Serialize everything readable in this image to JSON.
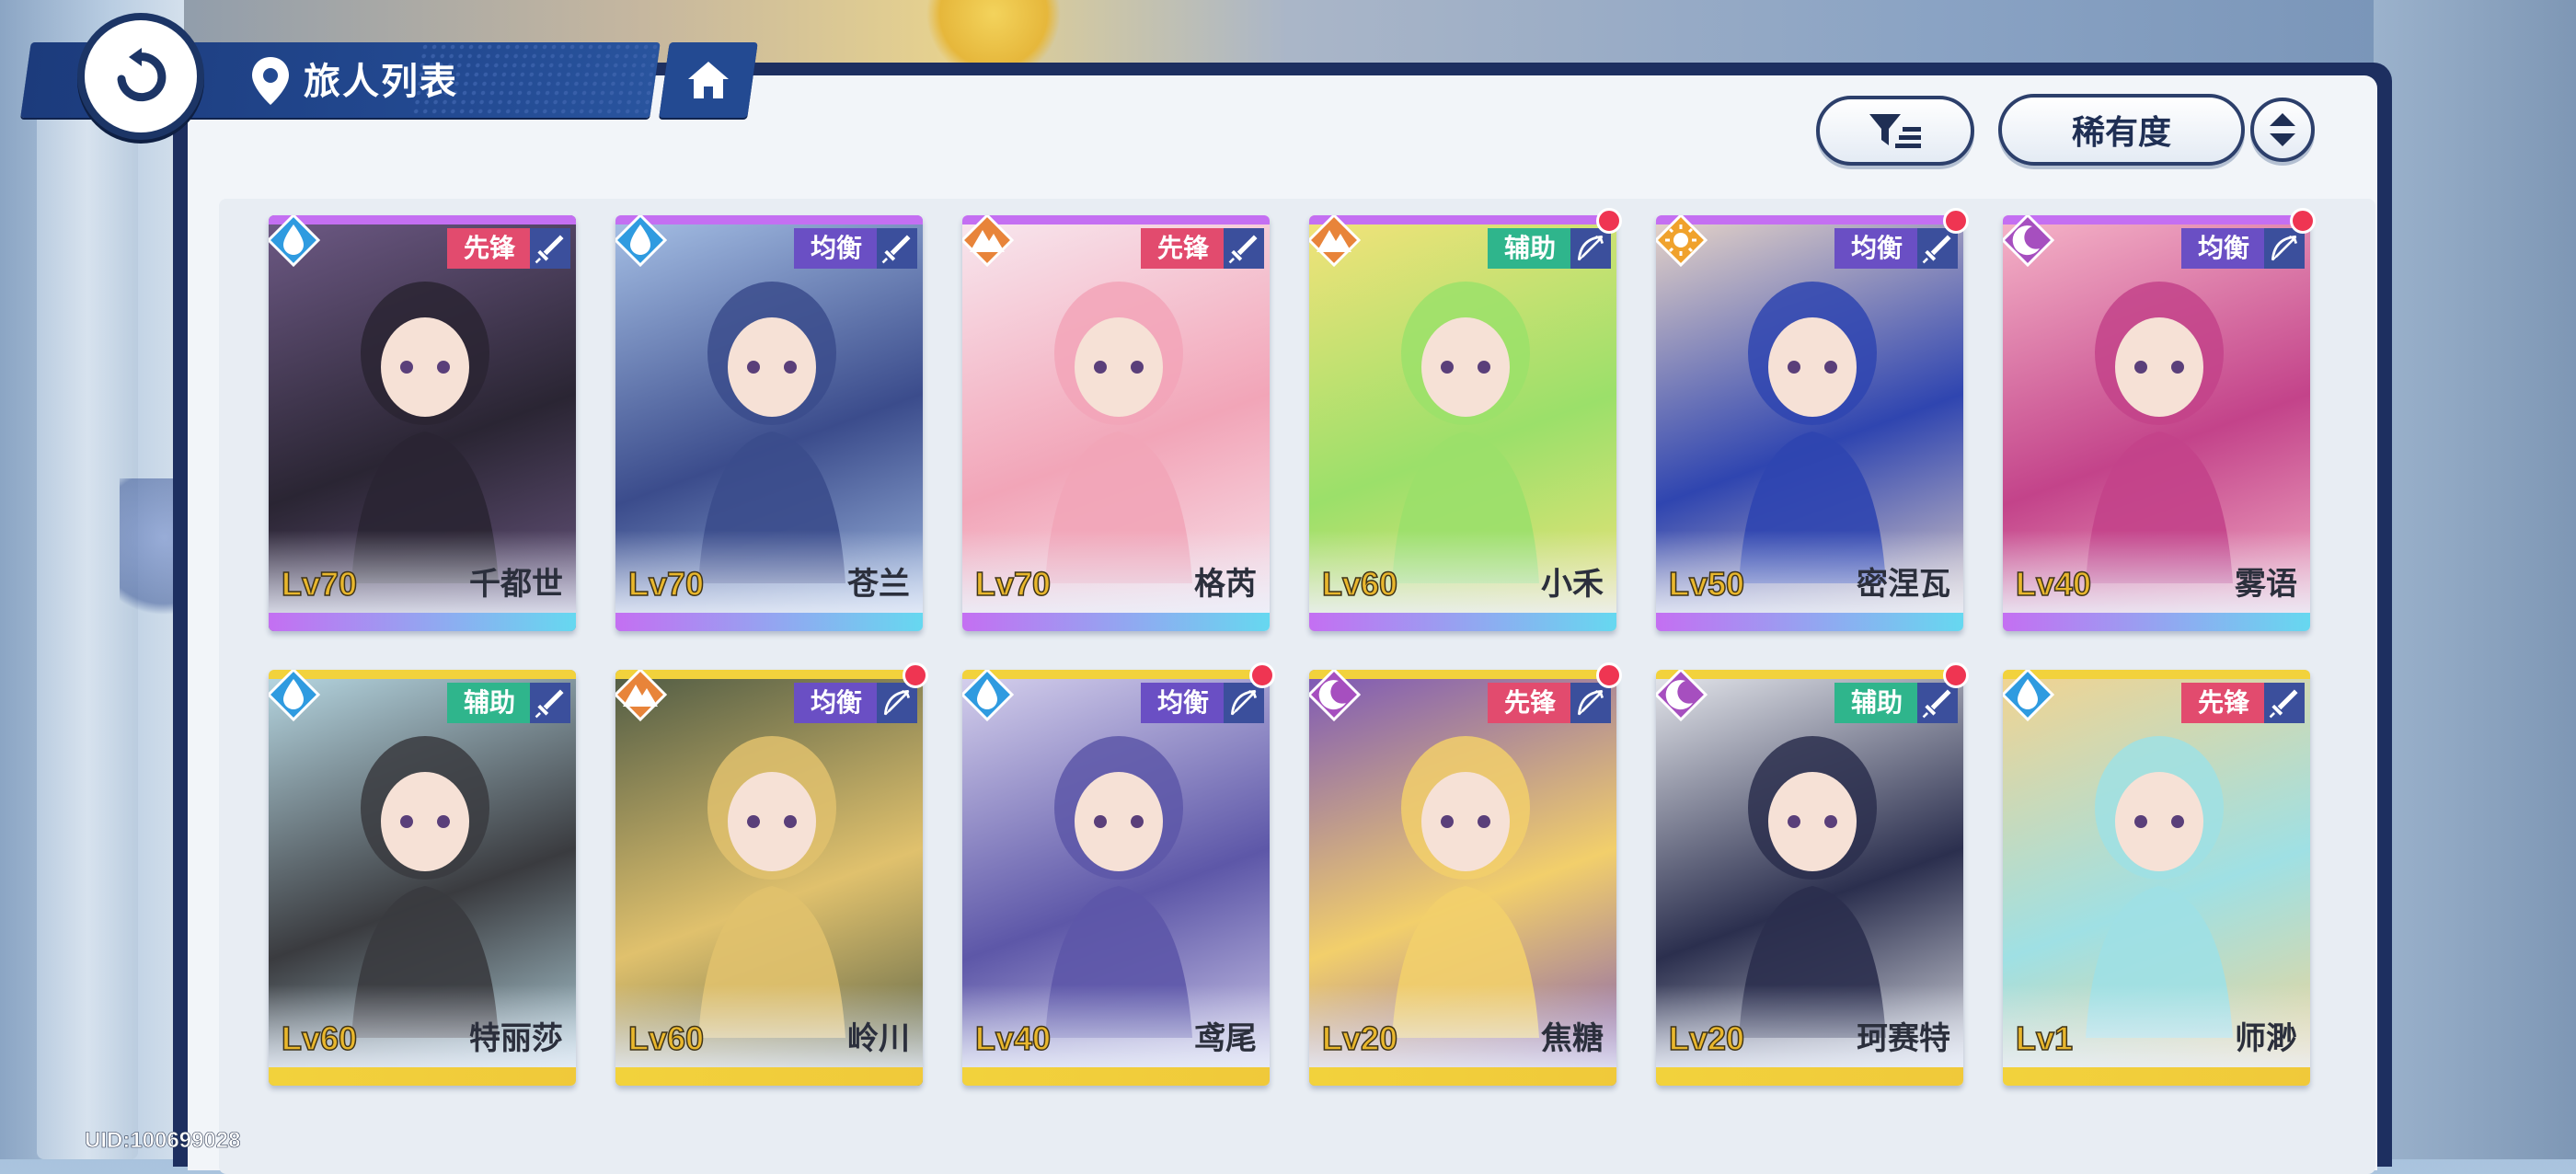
{
  "header": {
    "title": "旅人列表"
  },
  "toolbar": {
    "sort_label": "稀有度"
  },
  "footer": {
    "uid": "UID:100699028"
  },
  "colors": {
    "role_vanguard": "#e24b6e",
    "role_support": "#2fb58c",
    "role_balanced": "#6a4fc4",
    "rarity_top": "#c46ff2",
    "rarity_bottom": "#66d8f0",
    "rarity2_top": "#f2d23c",
    "rarity2_bottom": "#f0c93a"
  },
  "characters": [
    {
      "name": "千都世",
      "level": "Lv70",
      "role": "先锋",
      "element": "water-drop-icon",
      "weapon": "sword-icon",
      "rarity": "purple",
      "notify": false
    },
    {
      "name": "苍兰",
      "level": "Lv70",
      "role": "均衡",
      "element": "water-drop-icon",
      "weapon": "sword-icon",
      "rarity": "purple",
      "notify": false
    },
    {
      "name": "格芮",
      "level": "Lv70",
      "role": "先锋",
      "element": "mountain-icon",
      "weapon": "sword-icon",
      "rarity": "purple",
      "notify": false
    },
    {
      "name": "小禾",
      "level": "Lv60",
      "role": "辅助",
      "element": "mountain-icon",
      "weapon": "bow-icon",
      "rarity": "purple",
      "notify": true
    },
    {
      "name": "密涅瓦",
      "level": "Lv50",
      "role": "均衡",
      "element": "sun-icon",
      "weapon": "sword-icon",
      "rarity": "purple",
      "notify": true
    },
    {
      "name": "雾语",
      "level": "Lv40",
      "role": "均衡",
      "element": "moon-icon",
      "weapon": "bow-icon",
      "rarity": "purple",
      "notify": true
    },
    {
      "name": "特丽莎",
      "level": "Lv60",
      "role": "辅助",
      "element": "water-drop-icon",
      "weapon": "sword-icon",
      "rarity": "gold",
      "notify": false
    },
    {
      "name": "岭川",
      "level": "Lv60",
      "role": "均衡",
      "element": "mountain-icon",
      "weapon": "bow-icon",
      "rarity": "gold",
      "notify": true
    },
    {
      "name": "鸢尾",
      "level": "Lv40",
      "role": "均衡",
      "element": "water-drop-icon",
      "weapon": "bow-icon",
      "rarity": "gold",
      "notify": true
    },
    {
      "name": "焦糖",
      "level": "Lv20",
      "role": "先锋",
      "element": "moon-icon",
      "weapon": "bow-icon",
      "rarity": "gold",
      "notify": true
    },
    {
      "name": "珂赛特",
      "level": "Lv20",
      "role": "辅助",
      "element": "moon-icon",
      "weapon": "sword-icon",
      "rarity": "gold",
      "notify": true
    },
    {
      "name": "师渺",
      "level": "Lv1",
      "role": "先锋",
      "element": "water-drop-icon",
      "weapon": "sword-icon",
      "rarity": "gold",
      "notify": false
    }
  ]
}
